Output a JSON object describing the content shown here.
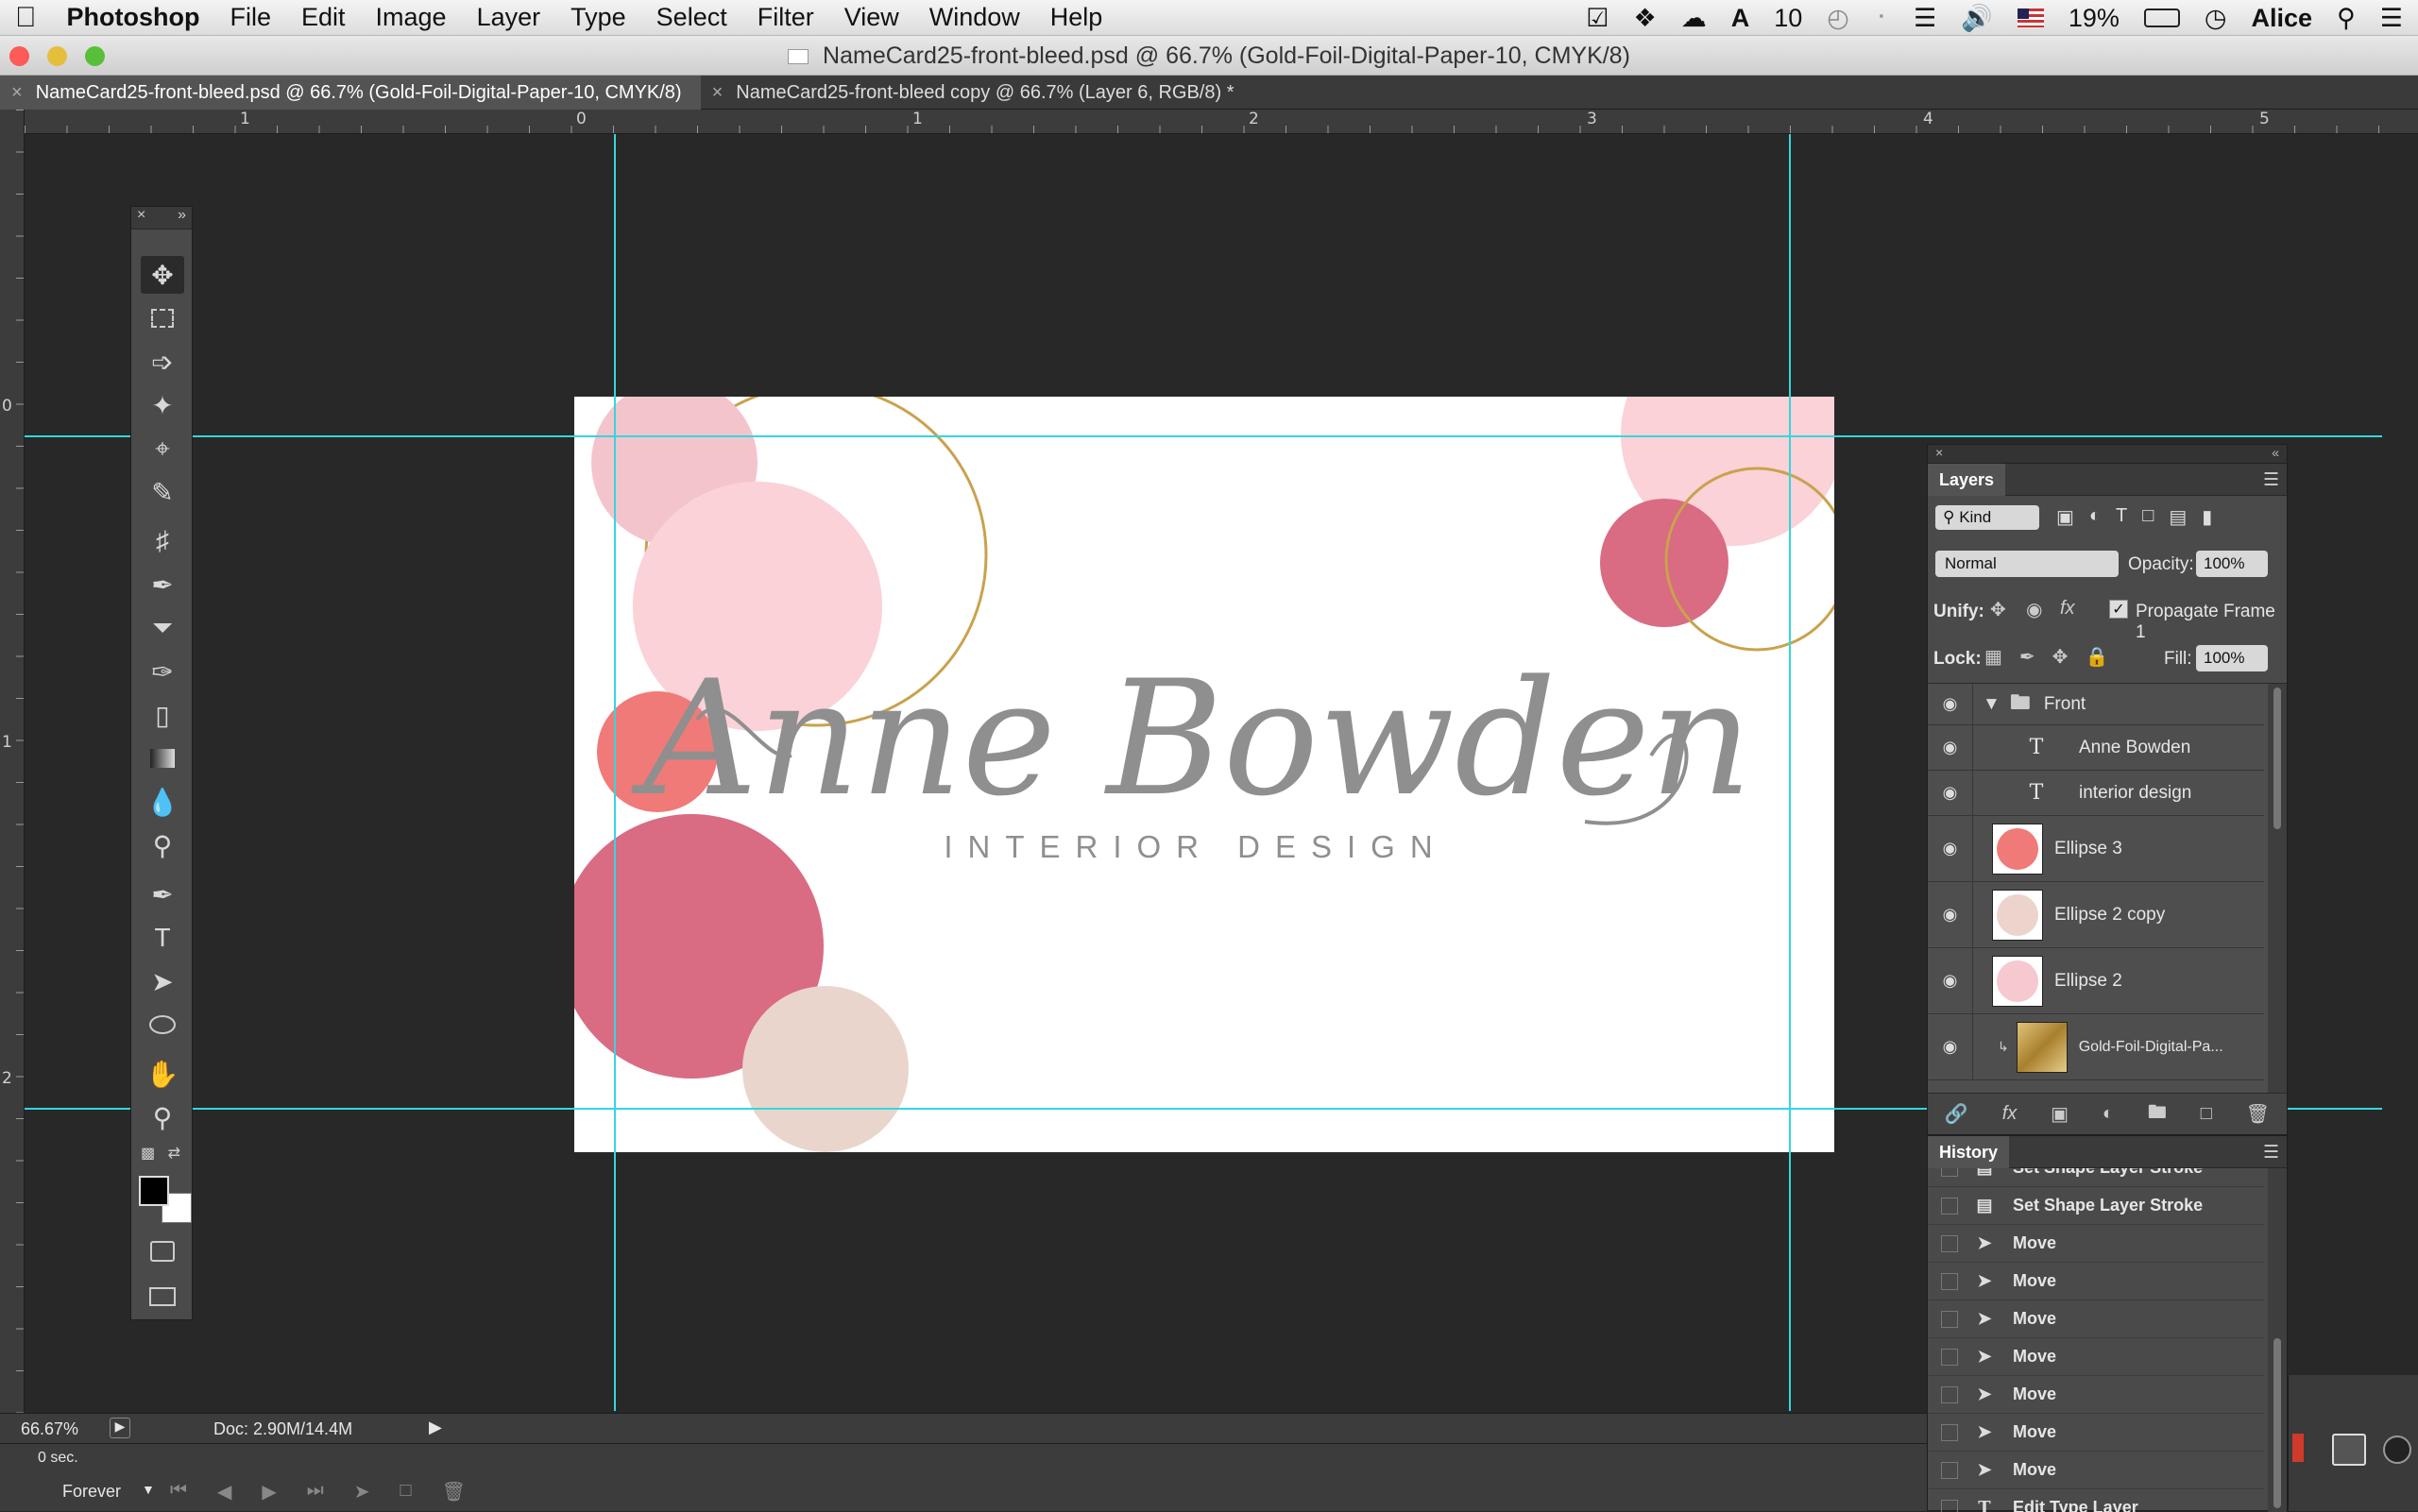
{
  "menubar": {
    "apple": "",
    "app_name": "Photoshop",
    "items": [
      "File",
      "Edit",
      "Image",
      "Layer",
      "Type",
      "Select",
      "Filter",
      "View",
      "Window",
      "Help"
    ],
    "status_count": "10",
    "battery": "19%",
    "user": "Alice"
  },
  "window": {
    "title": "NameCard25-front-bleed.psd @ 66.7% (Gold-Foil-Digital-Paper-10, CMYK/8)"
  },
  "tabs": [
    {
      "label": "NameCard25-front-bleed.psd @ 66.7% (Gold-Foil-Digital-Paper-10, CMYK/8)",
      "close": "×"
    },
    {
      "label": "NameCard25-front-bleed copy @ 66.7% (Layer 6, RGB/8) *",
      "close": "×"
    }
  ],
  "ruler": {
    "top": [
      "1",
      "0",
      "1",
      "2",
      "3",
      "4",
      "5"
    ],
    "left": [
      "0",
      "1",
      "2"
    ]
  },
  "card": {
    "name": "Anne Bowden",
    "subtitle": "INTERIOR DESIGN"
  },
  "layers": {
    "tab": "Layers",
    "filter_kind": "Kind",
    "blend_mode": "Normal",
    "opacity_label": "Opacity:",
    "opacity_value": "100%",
    "unify_label": "Unify:",
    "propagate_label": "Propagate Frame 1",
    "lock_label": "Lock:",
    "fill_label": "Fill:",
    "fill_value": "100%",
    "items": [
      {
        "name": "Front",
        "type": "group"
      },
      {
        "name": "Anne Bowden",
        "type": "text"
      },
      {
        "name": "interior design",
        "type": "text"
      },
      {
        "name": "Ellipse 3",
        "type": "shape",
        "color": "#f07a78"
      },
      {
        "name": "Ellipse 2 copy",
        "type": "shape",
        "color": "#ecd4cc"
      },
      {
        "name": "Ellipse 2",
        "type": "shape",
        "color": "#f6c8d0"
      },
      {
        "name": "Gold-Foil-Digital-Pa...",
        "type": "image",
        "color": "#c9a24e"
      }
    ]
  },
  "history": {
    "tab": "History",
    "items": [
      "Set Shape Layer Stroke",
      "Set Shape Layer Stroke",
      "Move",
      "Move",
      "Move",
      "Move",
      "Move",
      "Move",
      "Move",
      "Edit Type Layer"
    ]
  },
  "status": {
    "zoom": "66.67%",
    "doc": "Doc: 2.90M/14.4M",
    "frame_delay": "0 sec.",
    "loop": "Forever"
  },
  "colors": {
    "guide": "#35d6e0",
    "rose": "#d96b82",
    "coral": "#f07a78",
    "pink_light": "#fad2d8",
    "pink_mid": "#f4c4cc",
    "blush": "#ead5cc",
    "gold": "#c9a24e",
    "script_gray": "#8f8f8f"
  }
}
